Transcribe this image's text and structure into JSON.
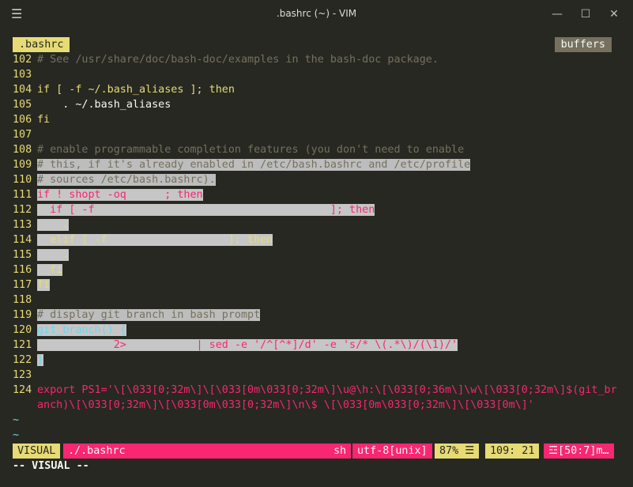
{
  "window": {
    "title": ".bashrc (~) - VIM",
    "menu_icon": "hamburger-icon",
    "minimize_icon": "minimize-icon",
    "maximize_icon": "maximize-icon",
    "close_icon": "close-icon"
  },
  "tabline": {
    "active_tab": ".bashrc",
    "buffers_label": "buffers"
  },
  "editor": {
    "lines": [
      {
        "n": "102",
        "text": "# See /usr/share/doc/bash-doc/examples in the bash-doc package."
      },
      {
        "n": "103",
        "text": ""
      },
      {
        "n": "104",
        "text": "if [ -f ~/.bash_aliases ]; then"
      },
      {
        "n": "105",
        "text": "    . ~/.bash_aliases"
      },
      {
        "n": "106",
        "text": "fi"
      },
      {
        "n": "107",
        "text": ""
      },
      {
        "n": "108",
        "text": "# enable programmable completion features (you don't need to enable"
      },
      {
        "n": "109",
        "text": "# this, if it's already enabled in /etc/bash.bashrc and /etc/profile"
      },
      {
        "n": "110",
        "text": "# sources /etc/bash.bashrc)."
      },
      {
        "n": "111",
        "text": "if ! shopt -oq      ; then"
      },
      {
        "n": "112",
        "text": "  if [ -f                                     ]; then"
      },
      {
        "n": "113",
        "text": "    ."
      },
      {
        "n": "114",
        "text": "  elif [ -f                   ]; then"
      },
      {
        "n": "115",
        "text": "    ."
      },
      {
        "n": "116",
        "text": "  fi"
      },
      {
        "n": "117",
        "text": "fi"
      },
      {
        "n": "118",
        "text": ""
      },
      {
        "n": "119",
        "text": "# display git branch in bash prompt"
      },
      {
        "n": "120",
        "text": "git_branch() {"
      },
      {
        "n": "121",
        "text": "            2>           | sed -e '/^[^*]/d' -e 's/* \\(.*\\)/(\\1)/'"
      },
      {
        "n": "122",
        "text": "}"
      },
      {
        "n": "123",
        "text": ""
      },
      {
        "n": "124",
        "text": "export PS1='\\[\\033[0;32m\\]\\[\\033[0m\\033[0;32m\\]\\u@\\h:\\[\\033[0;36m\\]\\w\\[\\033[0;32m\\]$(git_br"
      },
      {
        "n": "",
        "text": "anch)\\[\\033[0;32m\\]\\[\\033[0m\\033[0;32m\\]\\n\\$ \\[\\033[0m\\033[0;32m\\]\\[\\033[0m\\]'"
      }
    ],
    "tilde_lines": [
      "~",
      "~"
    ]
  },
  "statusline": {
    "mode": "VISUAL",
    "filename": "./.bashrc",
    "filetype": "sh",
    "encoding": "utf-8[unix]",
    "percent": "87% ☰",
    "position": "109: 21",
    "warning": "☲[50:7]m…"
  },
  "cmdline": "-- VISUAL --",
  "colors": {
    "background": "#272822",
    "yellow": "#e6db74",
    "pink": "#f92672",
    "comment": "#75715e",
    "cyan": "#66d9ef"
  }
}
